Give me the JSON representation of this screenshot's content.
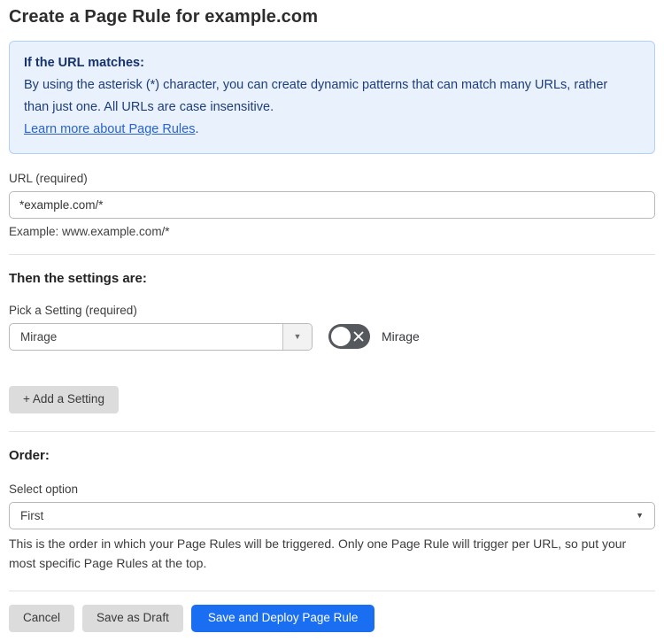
{
  "page": {
    "title": "Create a Page Rule for example.com"
  },
  "info_box": {
    "heading": "If the URL matches:",
    "body": "By using the asterisk (*) character, you can create dynamic patterns that can match many URLs, rather than just one. All URLs are case insensitive.",
    "link_label": "Learn more about Page Rules",
    "link_suffix": "."
  },
  "url_field": {
    "label": "URL (required)",
    "value": "*example.com/*",
    "helper": "Example: www.example.com/*"
  },
  "settings_section": {
    "heading": "Then the settings are:",
    "picker_label": "Pick a Setting (required)",
    "selected_setting": "Mirage",
    "toggle": {
      "label": "Mirage",
      "state": "off"
    },
    "add_button_label": "+ Add a Setting"
  },
  "order_section": {
    "heading": "Order:",
    "select_label": "Select option",
    "selected_option": "First",
    "helper": "This is the order in which your Page Rules will be triggered. Only one Page Rule will trigger per URL, so put your most specific Page Rules at the top."
  },
  "footer": {
    "cancel_label": "Cancel",
    "save_draft_label": "Save as Draft",
    "save_deploy_label": "Save and Deploy Page Rule"
  },
  "colors": {
    "info_bg": "#e9f1fc",
    "info_border": "#b6d0f2",
    "info_text": "#1e3d7b",
    "link_blue": "#2b63c9",
    "primary_button_blue": "#1a6ef2",
    "toggle_off_gray": "#55585c",
    "secondary_button_gray": "#dcdcdc"
  }
}
